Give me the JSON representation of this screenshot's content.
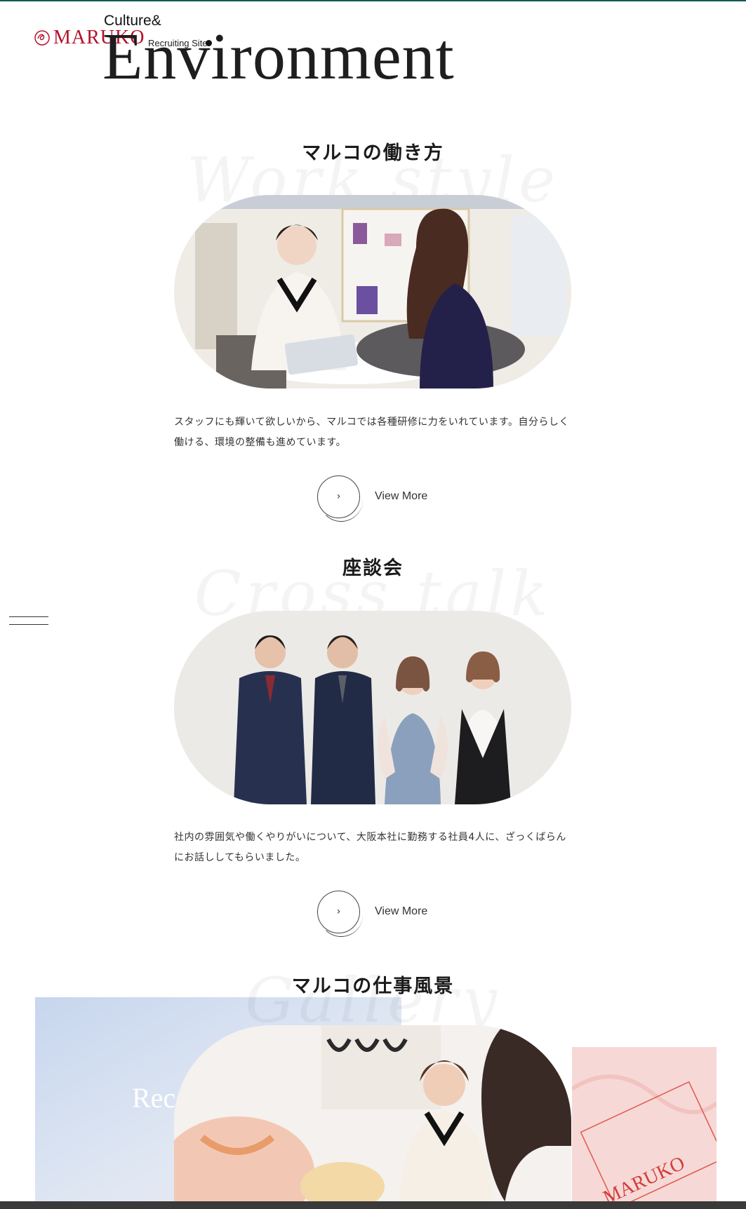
{
  "header": {
    "logo_text": "MARUKO",
    "site_label": "Recruiting Site",
    "kicker": "Culture&",
    "title": "Environment"
  },
  "menu": {
    "icon": "hamburger-icon"
  },
  "sections": [
    {
      "title": "マルコの働き方",
      "ghost": "Work style",
      "image": "staff-consultation-photo",
      "description": "スタッフにも輝いて欲しいから、マルコでは各種研修に力をいれています。自分らしく働ける、環境の整備も進めています。",
      "button_label": "View More",
      "button_icon": "›"
    },
    {
      "title": "座談会",
      "ghost": "Cross talk",
      "image": "employee-group-photo",
      "description": "社内の雰囲気や働くやりがいについて、大阪本社に勤務する社員4人に、ざっくばらんにお話ししてもらいました。",
      "button_label": "View More",
      "button_icon": "›"
    },
    {
      "title": "マルコの仕事風景",
      "ghost": "Gallery",
      "image": "staff-fitting-photo"
    }
  ],
  "gallery": {
    "recruit_card_text": "Rec",
    "brand_card_text": "MARUKO"
  },
  "colors": {
    "accent_top": "#0e5a55",
    "logo_red": "#b5122b",
    "text": "#222222"
  }
}
